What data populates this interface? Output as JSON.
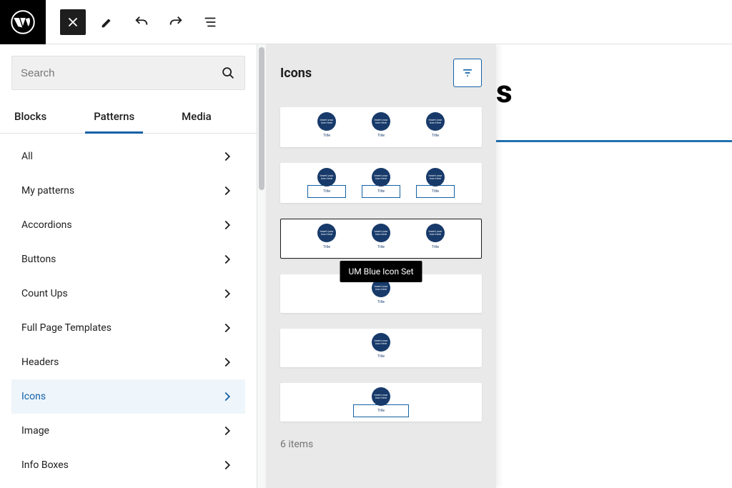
{
  "topbar": {},
  "search": {
    "placeholder": "Search"
  },
  "tabs": [
    {
      "label": "Blocks",
      "active": false
    },
    {
      "label": "Patterns",
      "active": true
    },
    {
      "label": "Media",
      "active": false
    }
  ],
  "categories": [
    {
      "label": "All",
      "selected": false
    },
    {
      "label": "My patterns",
      "selected": false
    },
    {
      "label": "Accordions",
      "selected": false
    },
    {
      "label": "Buttons",
      "selected": false
    },
    {
      "label": "Count Ups",
      "selected": false
    },
    {
      "label": "Full Page Templates",
      "selected": false
    },
    {
      "label": "Headers",
      "selected": false
    },
    {
      "label": "Icons",
      "selected": true
    },
    {
      "label": "Image",
      "selected": false
    },
    {
      "label": "Info Boxes",
      "selected": false
    }
  ],
  "patterns": {
    "title": "Icons",
    "items_count": "6 items",
    "tooltip": "UM Blue Icon Set",
    "mini_label": "Title",
    "mini_circle_text": "Insert your icon here"
  },
  "canvas": {
    "title_fragment": "s"
  }
}
